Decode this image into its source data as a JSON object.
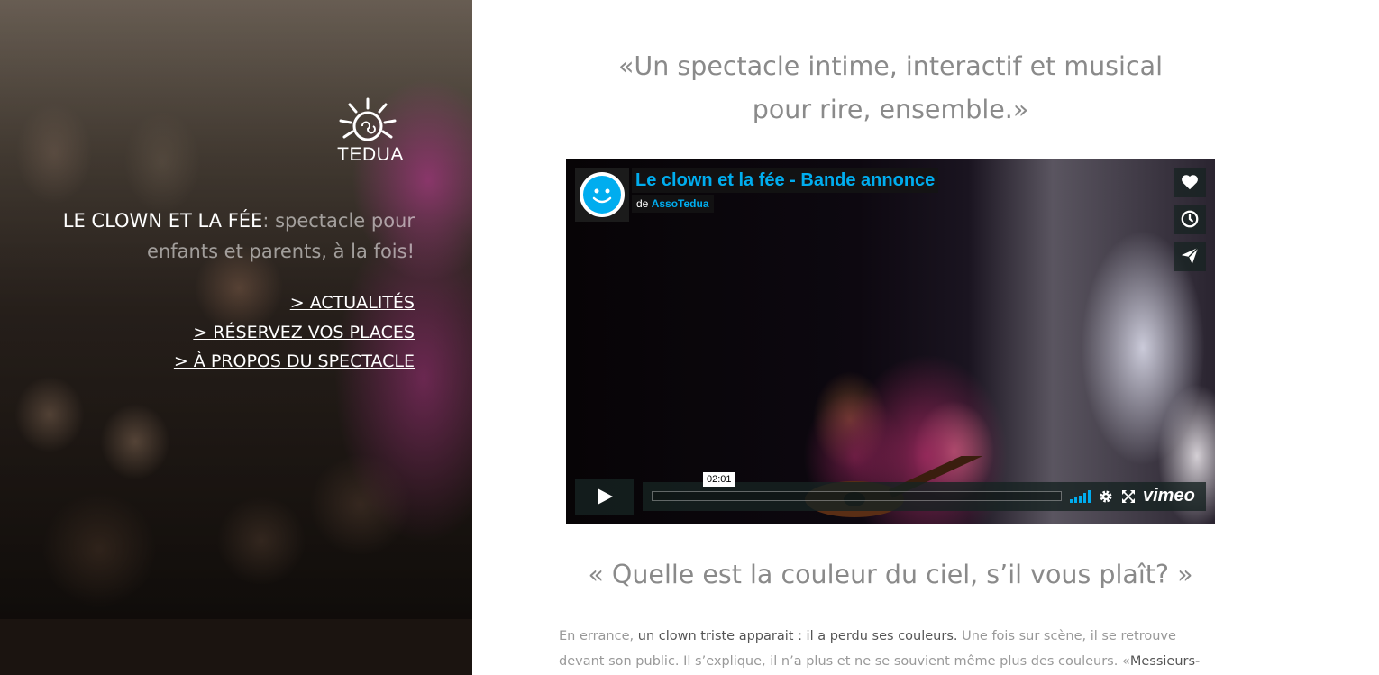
{
  "brand": {
    "logo_text": "TEDUA"
  },
  "sidebar": {
    "tagline_title": "LE CLOWN ET LA FÉE",
    "tagline_rest": ": spectacle pour enfants et parents, à la fois!",
    "nav": [
      {
        "label": "> ACTUALITÉS"
      },
      {
        "label": "> RÉSERVEZ VOS PLACES"
      },
      {
        "label": "> À PROPOS DU SPECTACLE"
      }
    ]
  },
  "main": {
    "quote_line1": "«Un spectacle intime, interactif et musical",
    "quote_line2": "pour rire, ensemble.»",
    "video": {
      "title": "Le clown et la fée - Bande annonce",
      "byline_prefix": "de",
      "owner": "AssoTedua",
      "time_tooltip": "02:01",
      "progress": 0,
      "side_buttons": [
        "heart-icon",
        "clock-icon",
        "paper-plane-icon"
      ],
      "brand_label": "vimeo",
      "accent_color": "#00adef"
    },
    "question": "« Quelle est la couleur du ciel, s’il vous plaît? »",
    "story": {
      "p1_a": "En errance, ",
      "p1_b": "un clown triste apparait : il a perdu ses couleurs.",
      "p1_c": " Une fois sur scène, il se retrouve devant son public. Il s’explique, il n’a plus et ne se souvient même plus des couleurs. «",
      "p1_d": "Messieurs-dames les enfants et"
    }
  }
}
